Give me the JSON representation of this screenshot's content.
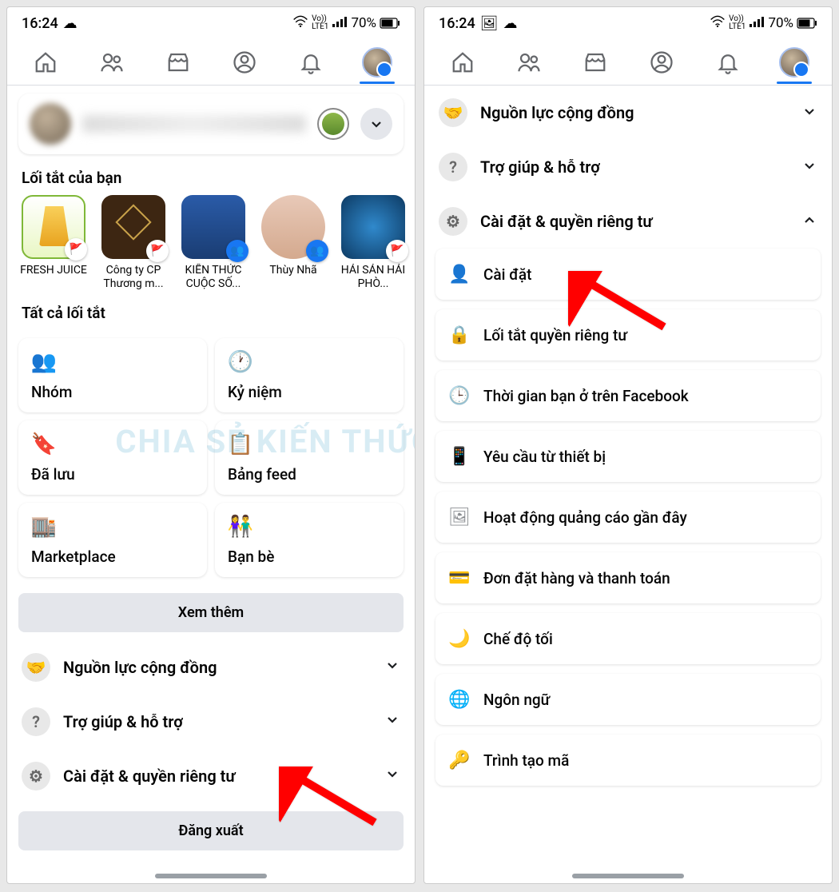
{
  "status": {
    "time": "16:24",
    "network": "LTE1",
    "battery_text": "70%"
  },
  "profile": {
    "name_hidden": true
  },
  "sections": {
    "shortcuts_title": "Lối tắt của bạn",
    "all_shortcuts_title": "Tất cả lối tắt"
  },
  "shortcuts": [
    {
      "label": "FRESH JUICE"
    },
    {
      "label": "Công ty CP Thương m..."
    },
    {
      "label": "KIẾN THỨC CUỘC SỐ..."
    },
    {
      "label": "Thùy Nhã"
    },
    {
      "label": "HẢI SẢN HẢI PHÒ..."
    }
  ],
  "grid": [
    {
      "label": "Nhóm"
    },
    {
      "label": "Kỷ niệm"
    },
    {
      "label": "Đã lưu"
    },
    {
      "label": "Bảng feed"
    },
    {
      "label": "Marketplace"
    },
    {
      "label": "Bạn bè"
    }
  ],
  "buttons": {
    "see_more": "Xem thêm",
    "logout": "Đăng xuất"
  },
  "collapse": [
    {
      "label": "Nguồn lực cộng đồng"
    },
    {
      "label": "Trợ giúp & hỗ trợ"
    },
    {
      "label": "Cài đặt & quyền riêng tư"
    }
  ],
  "settings_items": [
    {
      "label": "Cài đặt"
    },
    {
      "label": "Lối tắt quyền riêng tư"
    },
    {
      "label": "Thời gian bạn ở trên Facebook"
    },
    {
      "label": "Yêu cầu từ thiết bị"
    },
    {
      "label": "Hoạt động quảng cáo gần đây"
    },
    {
      "label": "Đơn đặt hàng và thanh toán"
    },
    {
      "label": "Chế độ tối"
    },
    {
      "label": "Ngôn ngữ"
    },
    {
      "label": "Trình tạo mã"
    }
  ],
  "watermark": "CHIA SẺ KIẾN THỨC"
}
